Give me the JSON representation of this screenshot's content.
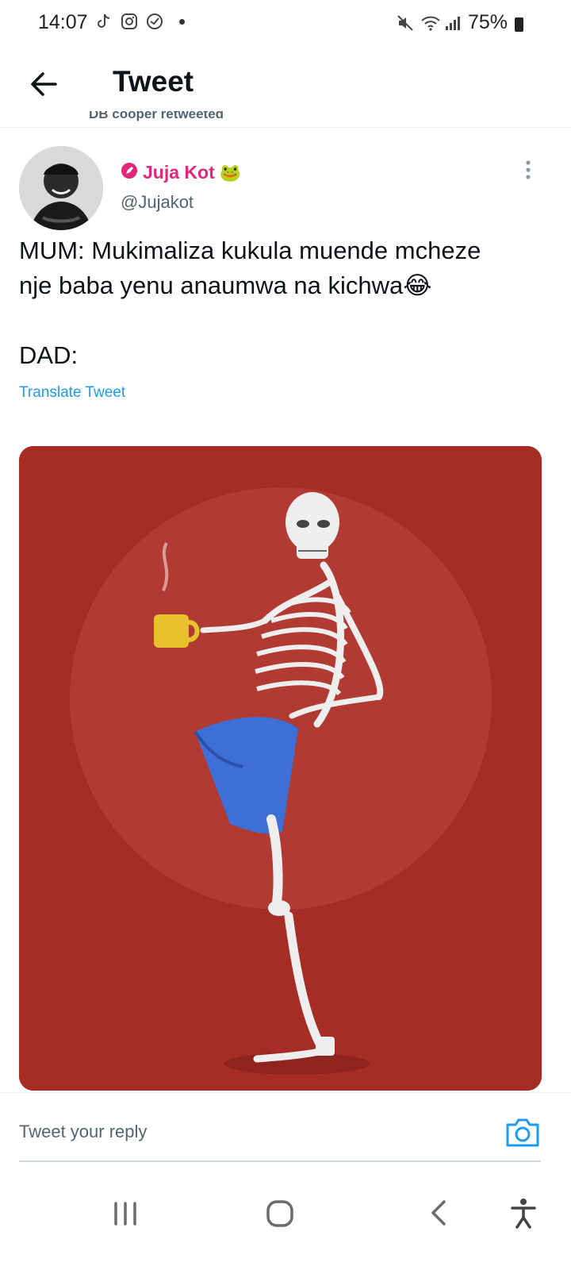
{
  "status_bar": {
    "time": "14:07",
    "battery": "75%",
    "icons": [
      "tiktok-icon",
      "instagram-icon",
      "vpn-icon",
      "mute-icon",
      "wifi-icon",
      "signal-icon",
      "battery-icon"
    ]
  },
  "header": {
    "title": "Tweet"
  },
  "retweet_label": "DB cooper retweeted",
  "tweet": {
    "author_name": "Juja Kot",
    "author_emoji": "🐸",
    "handle": "@Jujakot",
    "text_lines": [
      "MUM: Mukimaliza kukula muende mcheze",
      "nje baba yenu anaumwa na kichwa😂",
      "DAD:"
    ],
    "translate_label": "Translate Tweet"
  },
  "reply": {
    "placeholder": "Tweet your reply"
  },
  "colors": {
    "accent": "#1d9bf0",
    "author_pink": "#e0267d",
    "media_bg": "#a52d26"
  }
}
